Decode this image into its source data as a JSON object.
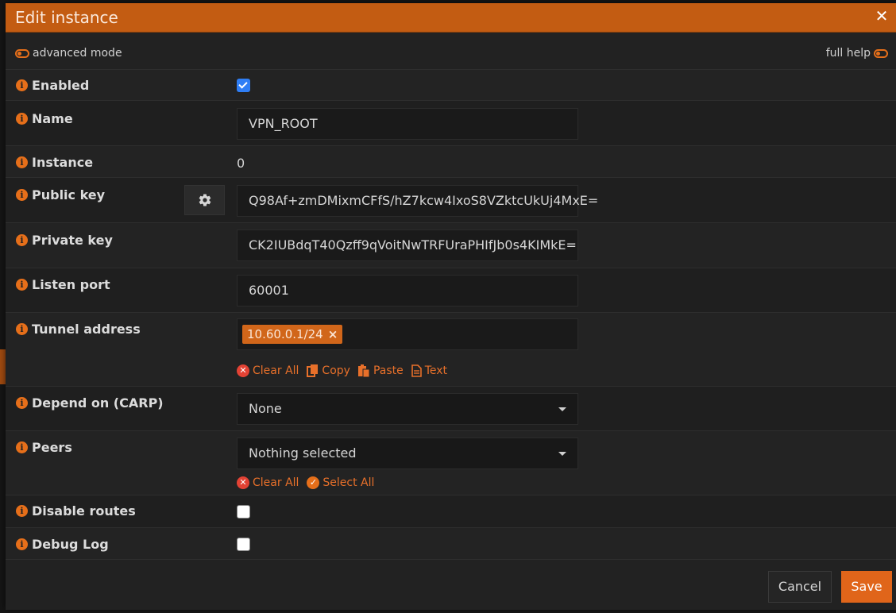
{
  "modal": {
    "title": "Edit instance",
    "advanced_mode_label": "advanced mode",
    "full_help_label": "full help"
  },
  "fields": {
    "enabled": {
      "label": "Enabled",
      "checked": true
    },
    "name": {
      "label": "Name",
      "value": "VPN_ROOT"
    },
    "instance": {
      "label": "Instance",
      "value": "0"
    },
    "public_key": {
      "label": "Public key",
      "value": "Q98Af+zmDMixmCFfS/hZ7kcw4IxoS8VZktcUkUj4MxE="
    },
    "private_key": {
      "label": "Private key",
      "value": "CK2IUBdqT40Qzff9qVoitNwTRFUraPHIfJb0s4KIMkE="
    },
    "listen_port": {
      "label": "Listen port",
      "value": "60001"
    },
    "tunnel_address": {
      "label": "Tunnel address",
      "tags": [
        "10.60.0.1/24"
      ],
      "actions": {
        "clear_all": "Clear All",
        "copy": "Copy",
        "paste": "Paste",
        "text": "Text"
      }
    },
    "depend_on": {
      "label": "Depend on (CARP)",
      "value": "None"
    },
    "peers": {
      "label": "Peers",
      "value": "Nothing selected",
      "actions": {
        "clear_all": "Clear All",
        "select_all": "Select All"
      }
    },
    "disable_routes": {
      "label": "Disable routes",
      "checked": false
    },
    "debug_log": {
      "label": "Debug Log",
      "checked": false
    }
  },
  "footer": {
    "cancel_label": "Cancel",
    "save_label": "Save"
  },
  "colors": {
    "accent": "#e0651a",
    "header": "#c35c12",
    "checkbox_checked": "#2f7ef5",
    "remove_red": "#e34234"
  }
}
